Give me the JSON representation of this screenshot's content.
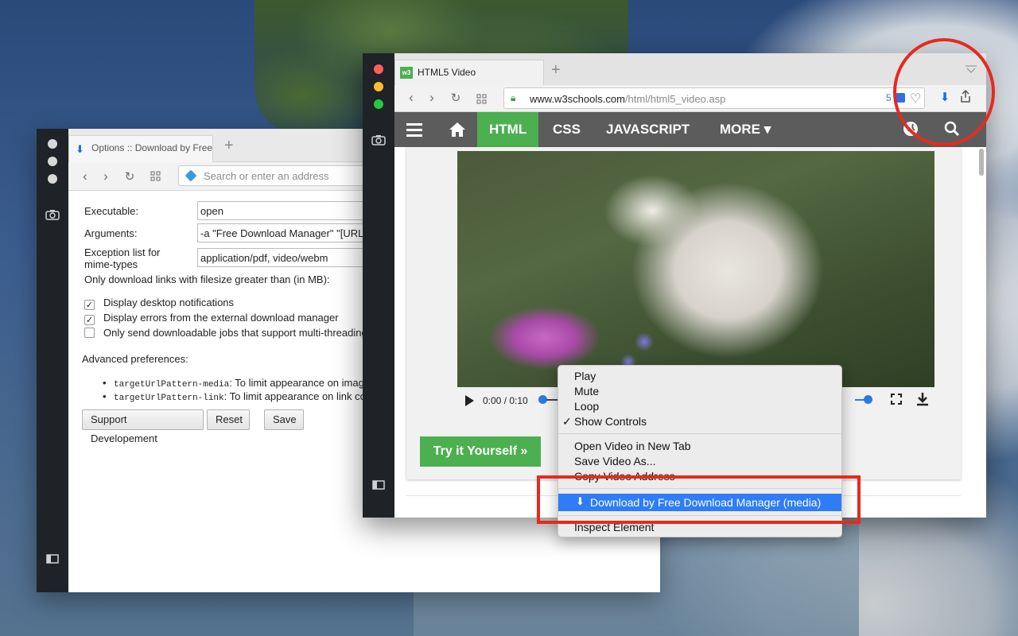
{
  "options_window": {
    "tab_title": "Options :: Download by Free",
    "address_placeholder": "Search or enter an address",
    "fields": {
      "executable_label": "Executable:",
      "executable_value": "open",
      "arguments_label": "Arguments:",
      "arguments_value": "-a \"Free Download Manager\" \"[URL]\"",
      "exception_label_1": "Exception list for",
      "exception_label_2": "mime-types",
      "exception_value": "application/pdf, video/webm",
      "filesize_label": "Only download links with filesize greater than (in MB):"
    },
    "checkboxes": [
      {
        "label": "Display desktop notifications",
        "checked": true
      },
      {
        "label": "Display errors from the external download manager",
        "checked": true
      },
      {
        "label": "Only send downloadable jobs that support multi-threading",
        "checked": false
      }
    ],
    "advanced_title": "Advanced preferences:",
    "advanced_items": [
      {
        "code": "targetUrlPattern-media",
        "text": ": To limit appearance on image, v"
      },
      {
        "code": "targetUrlPattern-link",
        "text": ": To limit appearance on link conte"
      }
    ],
    "buttons": {
      "support": "Support Developement",
      "reset": "Reset",
      "save": "Save"
    }
  },
  "browser_window": {
    "tab_title": "HTML5 Video",
    "tab_favicon": "w3",
    "url_host": "www.w3schools.com",
    "url_path": "/html/html5_video.asp",
    "badge_count": "5",
    "nav": {
      "html": "HTML",
      "css": "CSS",
      "javascript": "JAVASCRIPT",
      "more": "MORE ▾"
    },
    "video": {
      "time": "0:00 / 0:10"
    },
    "try_button": "Try it Yourself »"
  },
  "context_menu": {
    "items_group1": [
      "Play",
      "Mute",
      "Loop",
      "Show Controls"
    ],
    "show_controls_checked": true,
    "items_group2": [
      "Open Video in New Tab",
      "Save Video As...",
      "Copy Video Address"
    ],
    "highlighted": "Download by Free Download Manager (media)",
    "last": "Inspect Element"
  },
  "colors": {
    "w3_green": "#4caf50",
    "w3_nav": "#5c5c5c",
    "highlight_blue": "#2f7cf6",
    "annotation_red": "#e62a1e"
  }
}
